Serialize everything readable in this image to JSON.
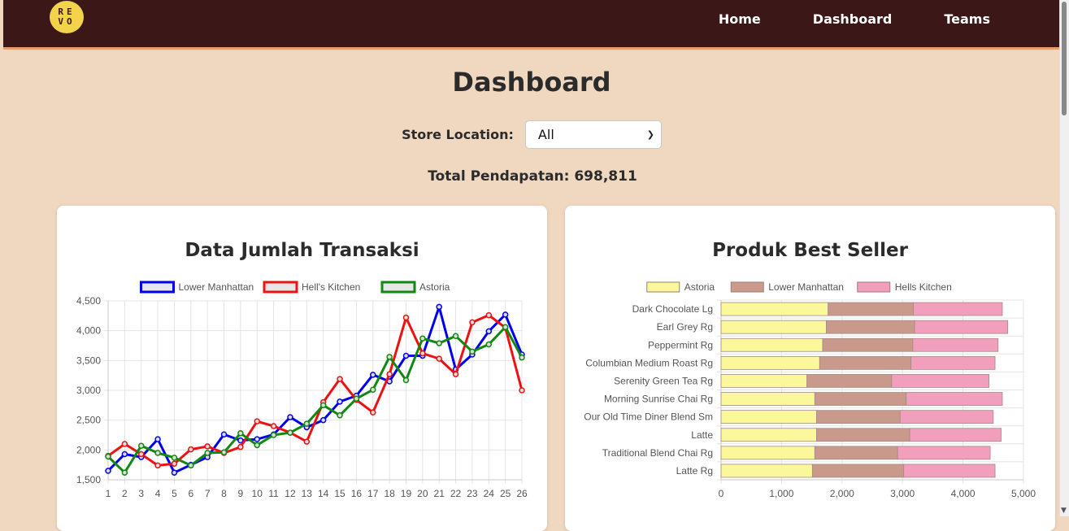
{
  "navbar": {
    "logo_text": "REVO",
    "logo_row1": "RE",
    "logo_row2": "VO",
    "links": [
      "Home",
      "Dashboard",
      "Teams"
    ],
    "background": "#3b1717"
  },
  "page": {
    "title": "Dashboard",
    "filter_label": "Store Location:",
    "filter_value": "All",
    "total_label": "Total Pendapatan: 698,811"
  },
  "charts": {
    "left_title": "Data Jumlah Transaksi",
    "right_title": "Produk Best Seller"
  },
  "chart_data": [
    {
      "type": "line",
      "title": "Data Jumlah Transaksi",
      "x": [
        1,
        2,
        3,
        4,
        5,
        6,
        7,
        8,
        9,
        10,
        11,
        12,
        13,
        14,
        15,
        16,
        17,
        18,
        19,
        20,
        21,
        22,
        23,
        24,
        25,
        26
      ],
      "ylim": [
        1500,
        4500
      ],
      "yticks": [
        1500,
        2000,
        2500,
        3000,
        3500,
        4000,
        4500
      ],
      "ytick_labels": [
        "1,500",
        "2,000",
        "2,500",
        "3,000",
        "3,500",
        "4,000",
        "4,500"
      ],
      "grid": true,
      "legend": "top",
      "series": [
        {
          "name": "Lower Manhattan",
          "color": "#0000ee",
          "values": [
            1650,
            1930,
            1880,
            2180,
            1620,
            1750,
            1880,
            2260,
            2160,
            2180,
            2260,
            2550,
            2380,
            2500,
            2810,
            2910,
            3260,
            3150,
            3580,
            3580,
            4400,
            3350,
            3600,
            3990,
            4270,
            3600
          ]
        },
        {
          "name": "Hell's Kitchen",
          "color": "#ee1111",
          "values": [
            1900,
            2100,
            1930,
            1740,
            1770,
            2010,
            2060,
            1950,
            2050,
            2480,
            2400,
            2290,
            2140,
            2800,
            3190,
            2840,
            2630,
            3270,
            4220,
            3620,
            3530,
            3270,
            4140,
            4260,
            4050,
            3000
          ]
        },
        {
          "name": "Astoria",
          "color": "#118811",
          "values": [
            1890,
            1620,
            2070,
            1950,
            1870,
            1740,
            1950,
            1960,
            2280,
            2080,
            2250,
            2290,
            2440,
            2750,
            2580,
            2860,
            3010,
            3560,
            3170,
            3870,
            3790,
            3910,
            3650,
            3770,
            4060,
            3550
          ]
        }
      ]
    },
    {
      "type": "bar",
      "orientation": "horizontal",
      "stacked": true,
      "title": "Produk Best Seller",
      "categories": [
        "Dark Chocolate Lg",
        "Earl Grey Rg",
        "Peppermint Rg",
        "Columbian Medium Roast Rg",
        "Serenity Green Tea Rg",
        "Morning Sunrise Chai Rg",
        "Our Old Time Diner Blend Sm",
        "Latte",
        "Traditional Blend Chai Rg",
        "Latte Rg"
      ],
      "xlim": [
        0,
        5000
      ],
      "xticks": [
        0,
        1000,
        2000,
        3000,
        4000,
        5000
      ],
      "xtick_labels": [
        "0",
        "1,000",
        "2,000",
        "3,000",
        "4,000",
        "5,000"
      ],
      "grid": true,
      "legend": "top",
      "series": [
        {
          "name": "Astoria",
          "color": "#fbf79b",
          "values": [
            1770,
            1740,
            1680,
            1630,
            1420,
            1550,
            1580,
            1580,
            1550,
            1510
          ]
        },
        {
          "name": "Lower Manhattan",
          "color": "#c99a8b",
          "values": [
            1410,
            1460,
            1490,
            1510,
            1400,
            1510,
            1380,
            1540,
            1370,
            1510
          ]
        },
        {
          "name": "Hells Kitchen",
          "color": "#f29ebd",
          "values": [
            1470,
            1540,
            1410,
            1390,
            1610,
            1590,
            1540,
            1510,
            1530,
            1510
          ]
        }
      ]
    }
  ]
}
